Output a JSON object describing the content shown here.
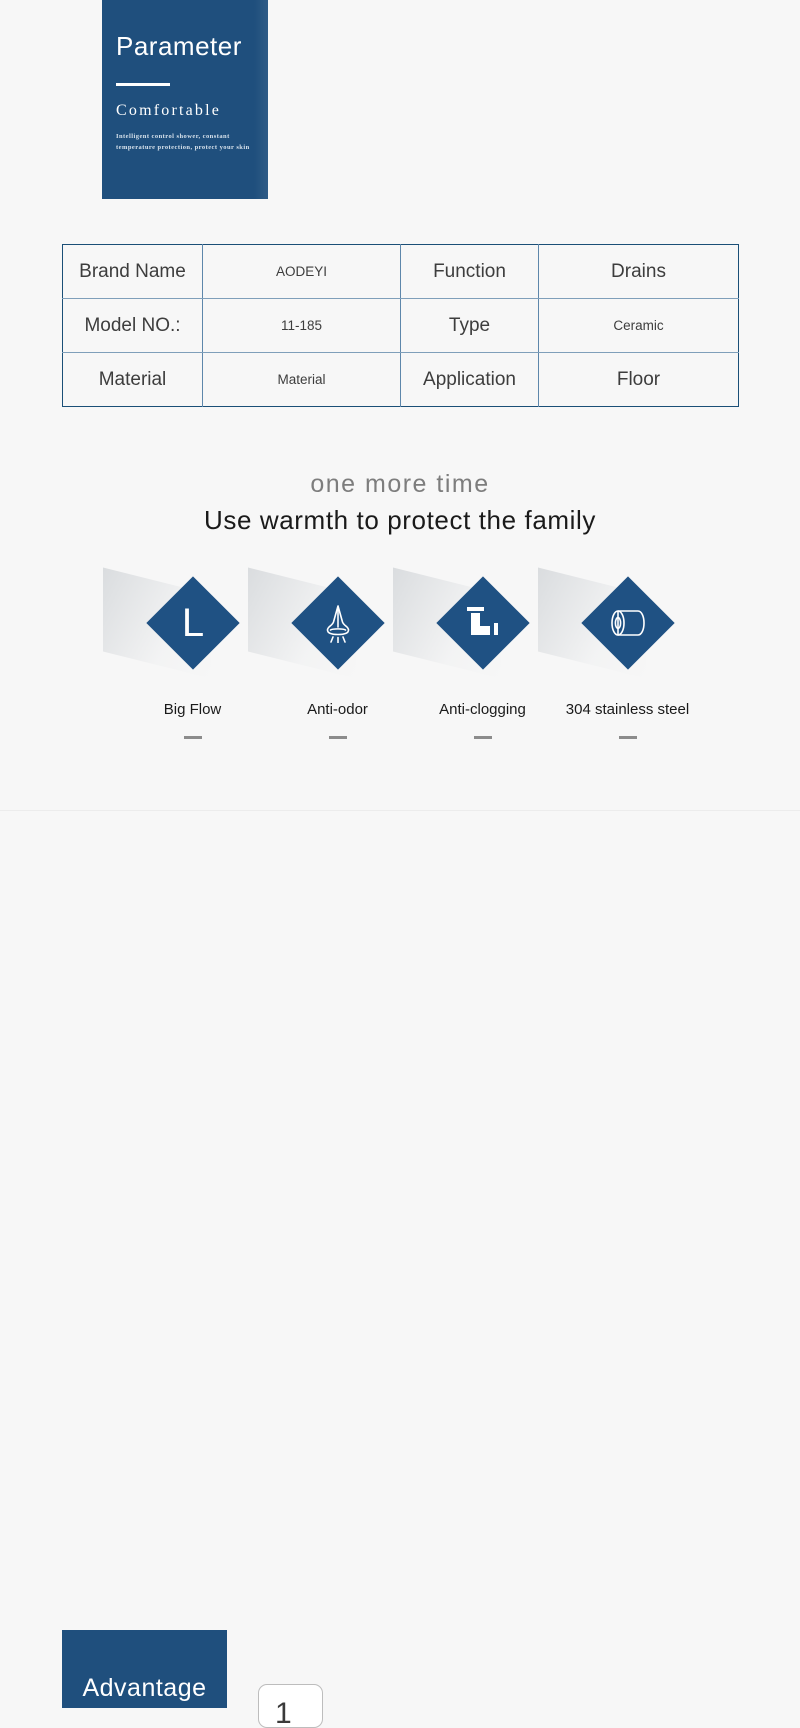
{
  "hero": {
    "title": "Parameter",
    "subtitle": "Comfortable",
    "description": "Intelligent control shower, constant temperature protection, protect your skin"
  },
  "spec_table": {
    "rows": [
      [
        {
          "text": "Brand Name",
          "style": "label"
        },
        {
          "text": "AODEYI",
          "style": "value"
        },
        {
          "text": "Function",
          "style": "label"
        },
        {
          "text": "Drains",
          "style": "value-lg"
        }
      ],
      [
        {
          "text": "Model NO.:",
          "style": "label"
        },
        {
          "text": "11-185",
          "style": "value"
        },
        {
          "text": "Type",
          "style": "label"
        },
        {
          "text": "Ceramic",
          "style": "value"
        }
      ],
      [
        {
          "text": "Material",
          "style": "label"
        },
        {
          "text": "Material",
          "style": "value"
        },
        {
          "text": "Application",
          "style": "label"
        },
        {
          "text": "Floor",
          "style": "value-lg"
        }
      ]
    ]
  },
  "headline": {
    "sub": "one more time",
    "main": "Use warmth to protect the family"
  },
  "features": [
    {
      "label": "Big Flow",
      "icon": "letter-l-icon"
    },
    {
      "label": "Anti-odor",
      "icon": "nose-icon"
    },
    {
      "label": "Anti-clogging",
      "icon": "pipe-elbow-icon"
    },
    {
      "label": "304 stainless steel",
      "icon": "steel-cylinder-icon"
    }
  ],
  "advantage": {
    "title": "Advantage",
    "card_number": "1"
  },
  "colors": {
    "brand_blue": "#1f4f7d",
    "diamond_blue": "#1f5183",
    "page_background": "#f7f7f7",
    "table_border": "#1b4f77",
    "table_inner_border": "#7f9fba",
    "headline_sub": "#7d7d7d",
    "dash_gray": "#8c8c8c"
  }
}
